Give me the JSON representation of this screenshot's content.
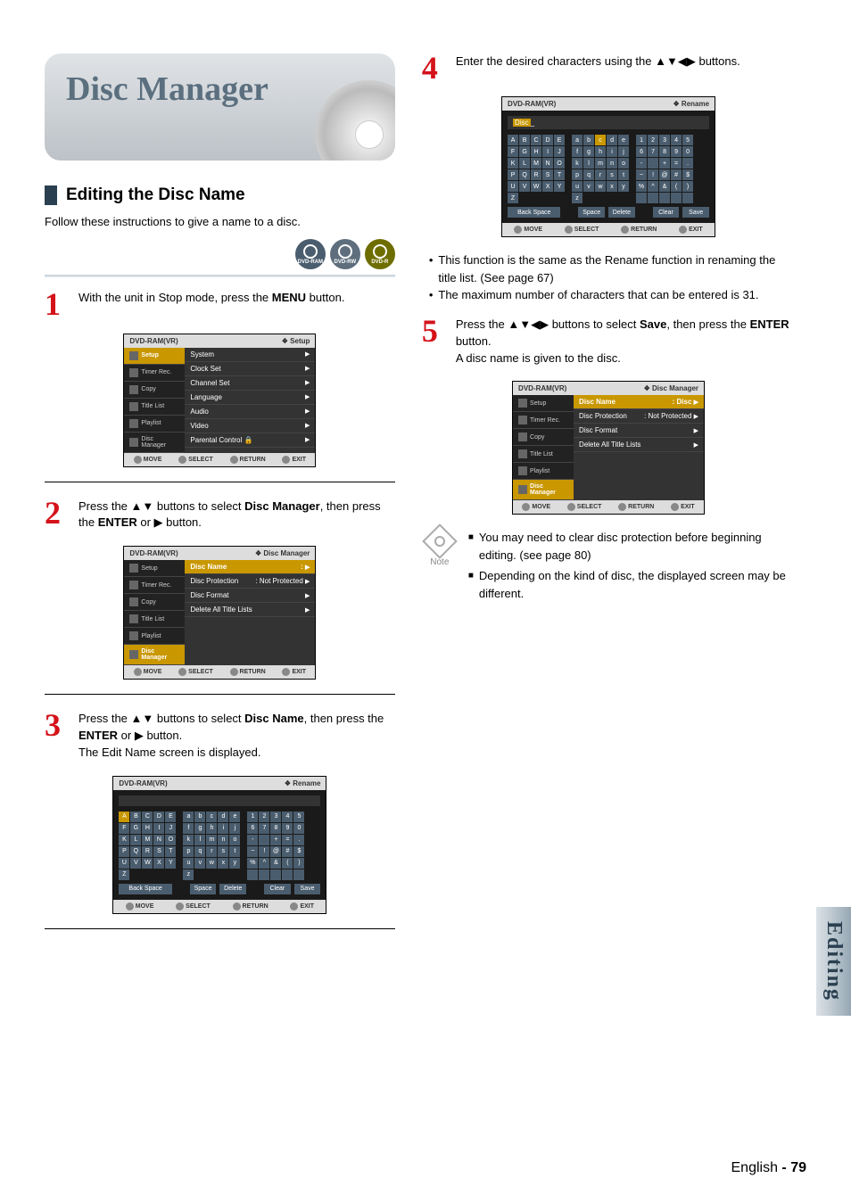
{
  "banner": {
    "title": "Disc Manager"
  },
  "section": {
    "heading": "Editing the Disc Name",
    "intro": "Follow these instructions to give a name to a disc."
  },
  "disc_badges": [
    "DVD-RAM",
    "DVD-RW",
    "DVD-R"
  ],
  "step1": {
    "num": "1",
    "text_a": "With the unit in Stop mode, press the ",
    "text_bold": "MENU",
    "text_b": " button."
  },
  "osd_common": {
    "device": "DVD-RAM(VR)",
    "sidebar": [
      "Setup",
      "Timer Rec.",
      "Copy",
      "Title List",
      "Playlist",
      "Disc Manager"
    ],
    "footer": {
      "move": "MOVE",
      "select": "SELECT",
      "return": "RETURN",
      "exit": "EXIT"
    }
  },
  "osd1": {
    "mode": "Setup",
    "menu": [
      "System",
      "Clock Set",
      "Channel Set",
      "Language",
      "Audio",
      "Video",
      "Parental Control"
    ]
  },
  "step2": {
    "num": "2",
    "text_a": "Press the ▲▼ buttons to select ",
    "text_bold": "Disc Manager",
    "text_b": ", then press the ",
    "text_bold2": "ENTER",
    "text_c": " or ▶ button."
  },
  "osd2": {
    "mode": "Disc Manager",
    "menu": [
      {
        "label": "Disc Name",
        "value": ":",
        "sel": true
      },
      {
        "label": "Disc Protection",
        "value": ": Not Protected"
      },
      {
        "label": "Disc Format",
        "value": ""
      },
      {
        "label": "Delete All Title Lists",
        "value": ""
      }
    ]
  },
  "step3": {
    "num": "3",
    "text_a": "Press the ▲▼ buttons to select ",
    "text_bold": "Disc Name",
    "text_b": ", then press the ",
    "text_bold2": "ENTER",
    "text_c": " or ▶ button.",
    "text_d": "The Edit Name screen is displayed."
  },
  "kbd": {
    "mode": "Rename",
    "input_empty": "",
    "input_disc": "Disc",
    "upper": [
      [
        "A",
        "B",
        "C",
        "D",
        "E"
      ],
      [
        "F",
        "G",
        "H",
        "I",
        "J"
      ],
      [
        "K",
        "L",
        "M",
        "N",
        "O"
      ],
      [
        "P",
        "Q",
        "R",
        "S",
        "T"
      ],
      [
        "U",
        "V",
        "W",
        "X",
        "Y"
      ],
      [
        "Z"
      ]
    ],
    "lower": [
      [
        "a",
        "b",
        "c",
        "d",
        "e"
      ],
      [
        "f",
        "g",
        "h",
        "i",
        "j"
      ],
      [
        "k",
        "l",
        "m",
        "n",
        "o"
      ],
      [
        "p",
        "q",
        "r",
        "s",
        "t"
      ],
      [
        "u",
        "v",
        "w",
        "x",
        "y"
      ],
      [
        "z"
      ]
    ],
    "nums": [
      [
        "1",
        "2",
        "3",
        "4",
        "5"
      ],
      [
        "6",
        "7",
        "8",
        "9",
        "0"
      ],
      [
        "-",
        "",
        "+",
        "=",
        "."
      ],
      [
        "~",
        "!",
        "@",
        "#",
        "$"
      ],
      [
        "%",
        "^",
        "&",
        "(",
        ")"
      ],
      [
        "",
        " ",
        " ",
        " ",
        " "
      ]
    ],
    "buttons": {
      "back": "Back Space",
      "space": "Space",
      "delete": "Delete",
      "clear": "Clear",
      "save": "Save"
    }
  },
  "step4": {
    "num": "4",
    "text": "Enter the desired characters using the ▲▼◀▶ buttons."
  },
  "step4_bullets": [
    "This function is the same as the Rename function in renaming the title list. (See page 67)",
    "The maximum number of characters that can be entered is 31."
  ],
  "step5": {
    "num": "5",
    "text_a": "Press the ▲▼◀▶ buttons to select ",
    "text_bold": "Save",
    "text_b": ", then press the ",
    "text_bold2": "ENTER",
    "text_c": " button.",
    "text_d": "A disc name is given to the disc."
  },
  "osd5": {
    "mode": "Disc Manager",
    "menu": [
      {
        "label": "Disc Name",
        "value": ": Disc",
        "sel": true
      },
      {
        "label": "Disc Protection",
        "value": ": Not Protected"
      },
      {
        "label": "Disc Format",
        "value": ""
      },
      {
        "label": "Delete All Title Lists",
        "value": ""
      }
    ]
  },
  "note": {
    "label": "Note",
    "items": [
      "You may need to clear disc protection before beginning editing. (see page 80)",
      "Depending on the kind of disc, the displayed screen may be different."
    ]
  },
  "side_tab": "Editing",
  "footer": {
    "lang": "English",
    "sep": " - ",
    "page": "79"
  }
}
